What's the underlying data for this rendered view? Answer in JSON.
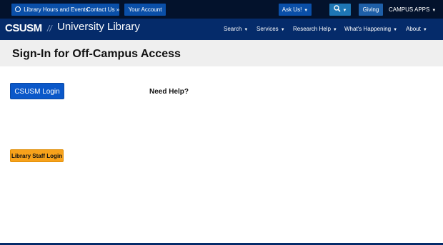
{
  "topbar": {
    "hours_label": "Library Hours and Events",
    "contact_label": "Contact Us »",
    "account_label": "Your Account",
    "ask_label": "Ask Us!",
    "giving_label": "Giving",
    "apps_label": "CAMPUS APPS"
  },
  "navbar": {
    "logo_text": "CSUSM",
    "separator": "//",
    "library_title": "University Library",
    "items": [
      {
        "label": "Search"
      },
      {
        "label": "Services"
      },
      {
        "label": "Research Help"
      },
      {
        "label": "What's Happening"
      },
      {
        "label": "About"
      }
    ]
  },
  "page": {
    "title": "Sign-In for Off-Campus Access",
    "login_button": "CSUSM Login",
    "need_help": "Need Help?",
    "staff_login_button": "Library Staff Login"
  },
  "colors": {
    "topbar_bg": "#03122c",
    "navbar_bg": "#052b6a",
    "button_blue": "#0b58c9",
    "button_orange": "#f7a21b"
  },
  "icons": [
    "clock-icon",
    "search-icon",
    "caret-down-icon"
  ]
}
